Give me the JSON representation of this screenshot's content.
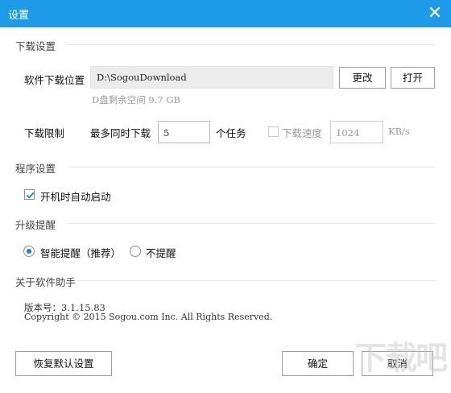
{
  "window": {
    "title": "设置",
    "close_icon": "close-icon"
  },
  "download": {
    "section": "下载设置",
    "location_label": "软件下载位置",
    "path": "D:\\SogouDownload",
    "change_button": "更改",
    "open_button": "打开",
    "free_space": "D盘剩余空间 9.7 GB",
    "limit_label": "下载限制",
    "max_label": "最多同时下载",
    "max_value": "5",
    "task_unit": "个任务",
    "speed_checked": false,
    "speed_label": "下载速度",
    "speed_value": "1024",
    "speed_unit": "KB/s"
  },
  "program": {
    "section": "程序设置",
    "autostart_label": "开机时自动启动",
    "autostart_checked": true
  },
  "upgrade": {
    "section": "升级提醒",
    "smart_label": "智能提醒（推荐）",
    "none_label": "不提醒",
    "selected": "smart"
  },
  "about": {
    "section": "关于软件助手",
    "version": "版本号：3.1.15.83",
    "copyright": "Copyright © 2015 Sogou.com Inc. All Rights Reserved."
  },
  "footer": {
    "restore_button": "恢复默认设置",
    "ok_button": "确定",
    "cancel_button": "取消"
  },
  "watermark": "下载吧",
  "colors": {
    "titlebar": "#1e9be8",
    "radio_selected": "#1e7fd0"
  }
}
